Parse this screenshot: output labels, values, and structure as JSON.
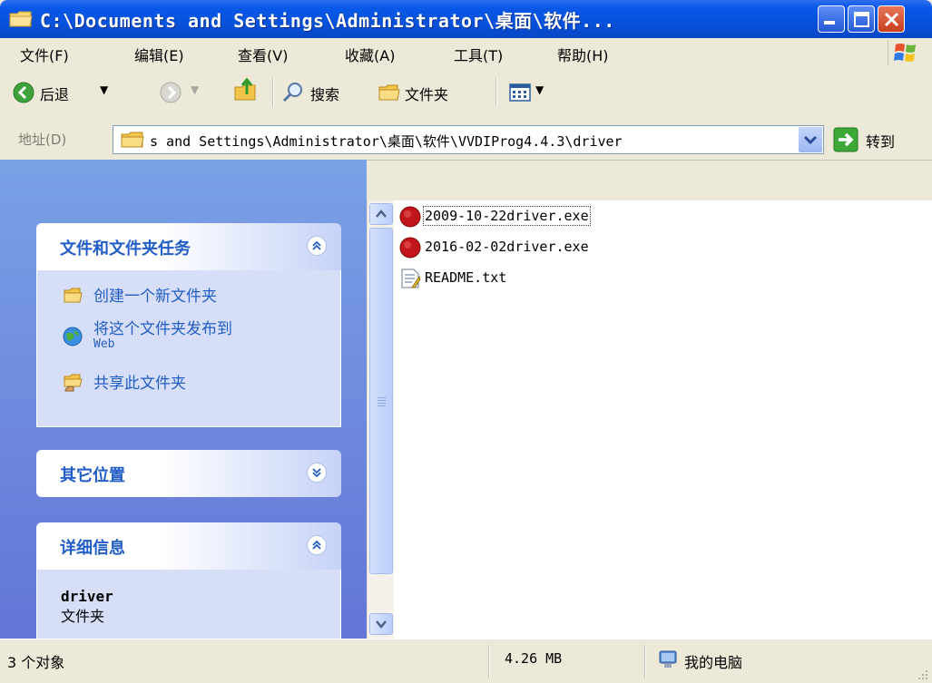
{
  "window": {
    "title": "C:\\Documents and Settings\\Administrator\\桌面\\软件...",
    "colors": {
      "titlebar": "#0652DB",
      "taskpane": "#7AA1E6",
      "link": "#215DC6",
      "chrome": "#ECE9D8"
    }
  },
  "menu": {
    "items": [
      {
        "label": "文件(F)"
      },
      {
        "label": "编辑(E)"
      },
      {
        "label": "查看(V)"
      },
      {
        "label": "收藏(A)"
      },
      {
        "label": "工具(T)"
      },
      {
        "label": "帮助(H)"
      }
    ]
  },
  "toolbar": {
    "back_label": "后退",
    "search_label": "搜索",
    "folders_label": "文件夹",
    "icons": [
      "back-icon",
      "forward-icon",
      "up-folder-icon",
      "search-icon",
      "folders-icon",
      "views-icon"
    ]
  },
  "address": {
    "label": "地址(D)",
    "value": "s and Settings\\Administrator\\桌面\\软件\\VVDIProg4.4.3\\driver",
    "go_label": "转到"
  },
  "sidebar": {
    "tasks_panel": {
      "title": "文件和文件夹任务",
      "items": [
        {
          "label": "创建一个新文件夹",
          "icon": "new-folder-icon"
        },
        {
          "label": "将这个文件夹发布到",
          "label2": "Web",
          "icon": "publish-web-icon"
        },
        {
          "label": "共享此文件夹",
          "icon": "share-folder-icon"
        }
      ]
    },
    "other_places": {
      "title": "其它位置"
    },
    "details": {
      "title": "详细信息",
      "name": "driver",
      "type": "文件夹"
    }
  },
  "files": [
    {
      "name": "2009-10-22driver.exe",
      "icon": "exe-red-icon",
      "focused": true
    },
    {
      "name": "2016-02-02driver.exe",
      "icon": "exe-red-icon",
      "focused": false
    },
    {
      "name": "README.txt",
      "icon": "text-file-icon",
      "focused": false
    }
  ],
  "status": {
    "object_count": "3 个对象",
    "size": "4.26 MB",
    "location": "我的电脑"
  }
}
